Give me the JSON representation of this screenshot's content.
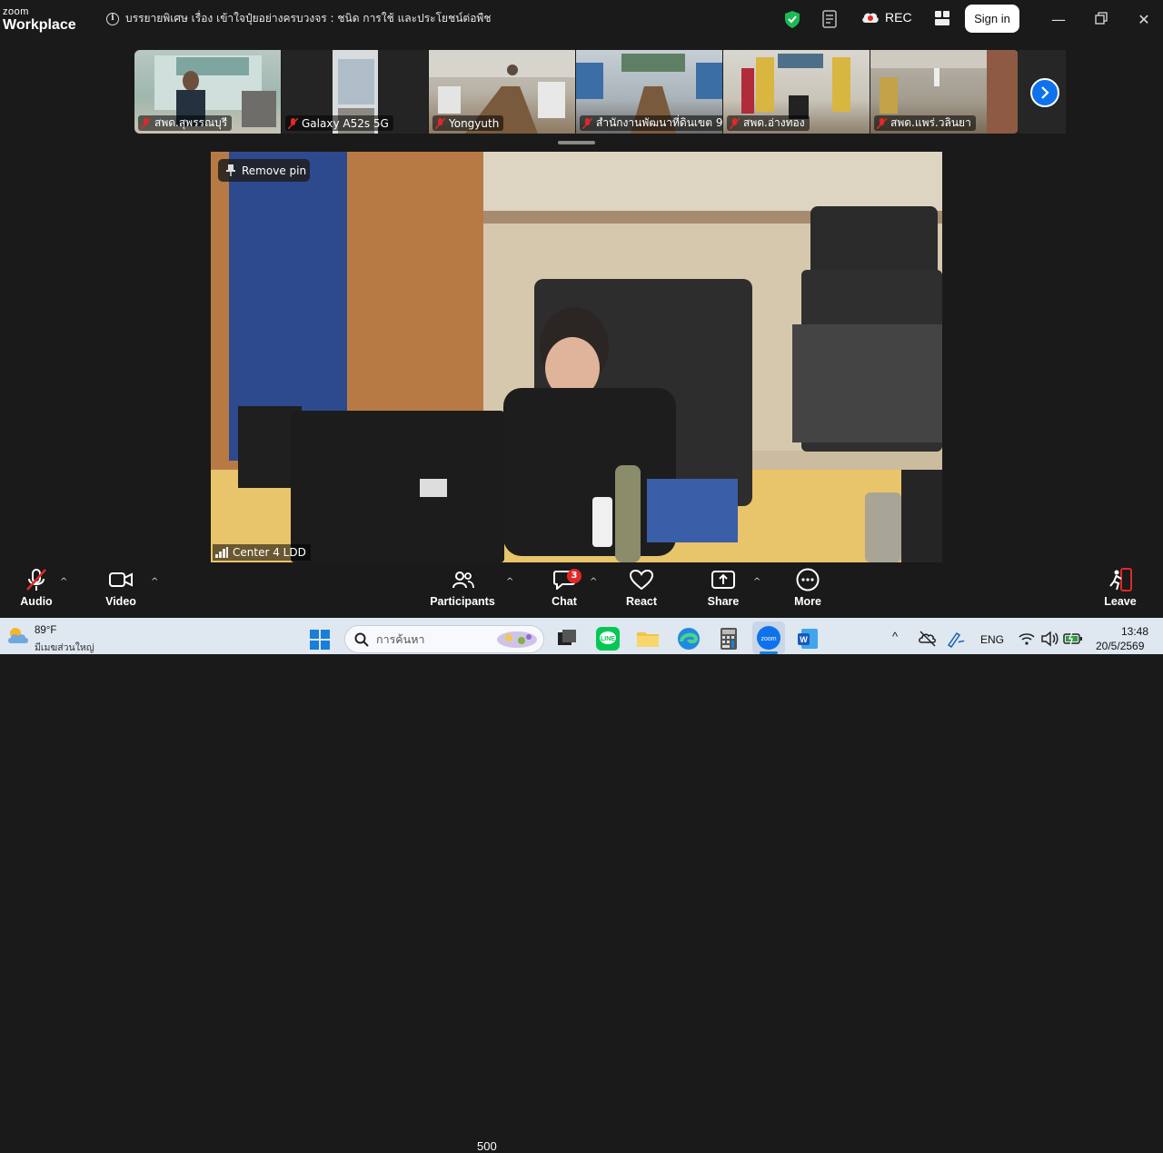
{
  "app": {
    "logo_top": "zoom",
    "logo_bottom": "Workplace"
  },
  "meeting": {
    "title": "บรรยายพิเศษ เรื่อง เข้าใจปุ๋ยอย่างครบวงจร : ชนิด การใช้ และประโยชน์ต่อพืช",
    "rec_label": "REC",
    "sign_in_label": "Sign in"
  },
  "thumbnails": [
    {
      "name": "สพด.สุพรรณบุรี"
    },
    {
      "name": "Galaxy A52s 5G"
    },
    {
      "name": "Yongyuth"
    },
    {
      "name": "สำนักงานพัฒนาที่ดินเขต 9"
    },
    {
      "name": "สพด.อ่างทอง"
    },
    {
      "name": "สพด.แพร่.วลินยา"
    }
  ],
  "main_video": {
    "pin_label": "Remove pin",
    "participant_name": "Center 4 LDD"
  },
  "toolbar": {
    "audio_label": "Audio",
    "video_label": "Video",
    "participants_label": "Participants",
    "participants_count": "500",
    "chat_label": "Chat",
    "chat_badge": "3",
    "react_label": "React",
    "share_label": "Share",
    "more_label": "More",
    "leave_label": "Leave"
  },
  "taskbar": {
    "weather_temp": "89°F",
    "weather_desc": "มีเมฆส่วนใหญ่",
    "search_placeholder": "การค้นหา",
    "language": "ENG",
    "time": "13:48",
    "date": "20/5/2569"
  },
  "colors": {
    "accent": "#0e72ed",
    "leave": "#e02828",
    "shield": "#1db954"
  }
}
